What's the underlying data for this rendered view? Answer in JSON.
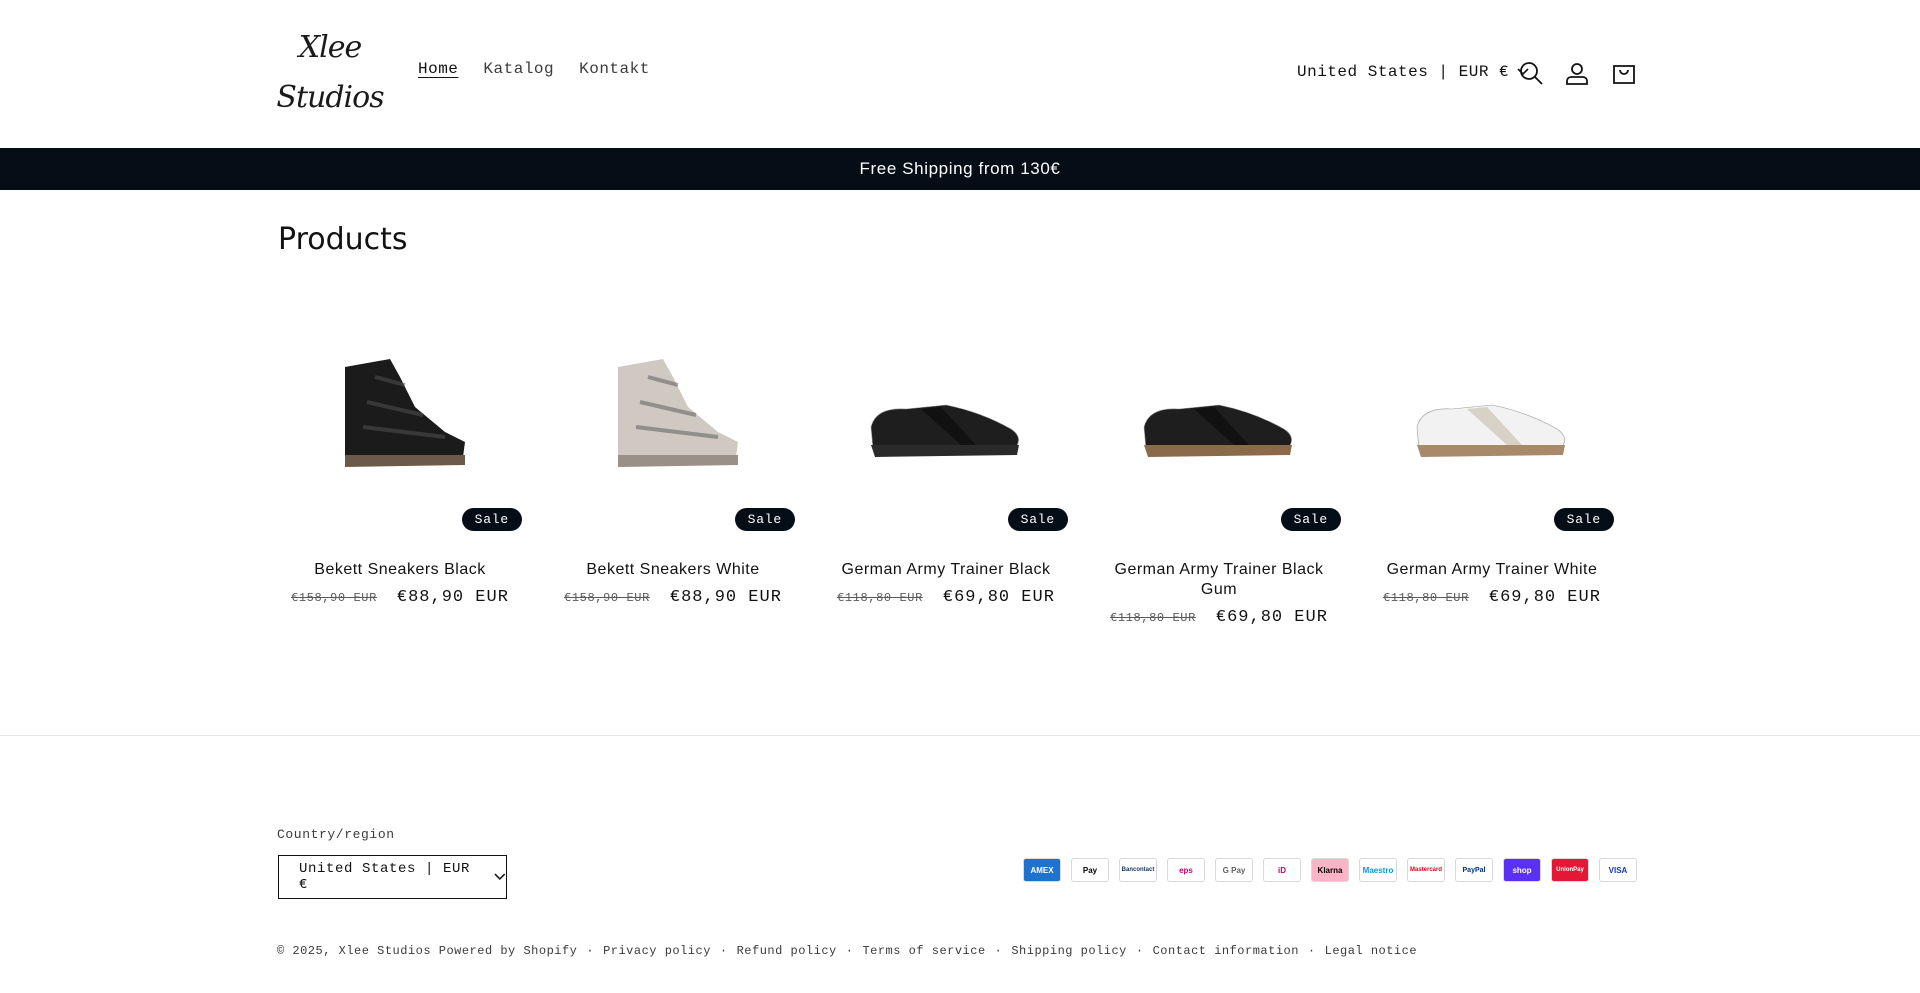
{
  "header": {
    "logo_line1": "Xlee",
    "logo_line2": "Studios",
    "nav": [
      {
        "label": "Home"
      },
      {
        "label": "Katalog"
      },
      {
        "label": "Kontakt"
      }
    ],
    "locale": "United States | EUR €"
  },
  "announcement": "Free Shipping from 130€",
  "products": {
    "title": "Products",
    "items": [
      {
        "name": "Bekett Sneakers Black",
        "badge": "Sale",
        "old_price": "€158,90 EUR",
        "price": "€88,90 EUR",
        "shoe": "wedge",
        "color": "#1b1b1b",
        "sole": "#6b5a4a"
      },
      {
        "name": "Bekett Sneakers White",
        "badge": "Sale",
        "old_price": "€158,90 EUR",
        "price": "€88,90 EUR",
        "shoe": "wedge",
        "color": "#cfc9c2",
        "sole": "#9a9088"
      },
      {
        "name": "German Army Trainer Black",
        "badge": "Sale",
        "old_price": "€118,80 EUR",
        "price": "€69,80 EUR",
        "shoe": "trainer",
        "color": "#1e1e1e",
        "sole": "#2a2a2a"
      },
      {
        "name": "German Army Trainer Black Gum",
        "badge": "Sale",
        "old_price": "€118,80 EUR",
        "price": "€69,80 EUR",
        "shoe": "trainer",
        "color": "#1e1e1e",
        "sole": "#8a6a4a"
      },
      {
        "name": "German Army Trainer White",
        "badge": "Sale",
        "old_price": "€118,80 EUR",
        "price": "€69,80 EUR",
        "shoe": "trainer",
        "color": "#f2f2f2",
        "sole": "#a88a6a"
      }
    ]
  },
  "footer": {
    "country_label": "Country/region",
    "country_value": "United States | EUR €",
    "payments": [
      "AMEX",
      "Pay",
      "Bancontact",
      "eps",
      "G Pay",
      "iD",
      "Klarna",
      "Maestro",
      "Mastercard",
      "PayPal",
      "shop",
      "UnionPay",
      "VISA"
    ],
    "copyright": "© 2025,",
    "store_link": "Xlee Studios",
    "powered": "Powered by Shopify",
    "links": [
      "Privacy policy",
      "Refund policy",
      "Terms of service",
      "Shipping policy",
      "Contact information",
      "Legal notice"
    ]
  }
}
